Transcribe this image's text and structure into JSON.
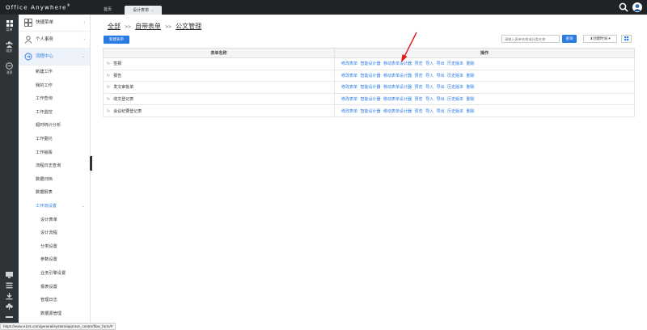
{
  "app": {
    "brand": "Office Anywhere",
    "brand_reg": "®",
    "tabs": [
      {
        "label": "首页"
      },
      {
        "label": "设计表单",
        "close": "×"
      }
    ]
  },
  "rail": {
    "items": [
      {
        "label": "菜单",
        "icon": "grid-icon"
      },
      {
        "label": "组织",
        "icon": "org-icon"
      },
      {
        "label": "消息",
        "icon": "message-icon"
      }
    ]
  },
  "sidebar": {
    "groups": [
      {
        "label": "快捷菜单",
        "icon": "shortcut-icon",
        "chevron": "›"
      },
      {
        "label": "个人事务",
        "icon": "person-icon",
        "chevron": "›"
      },
      {
        "label": "流程中心",
        "icon": "flow-icon",
        "chevron": "⌄"
      }
    ],
    "items": [
      "新建工作",
      "我的工作",
      "工作查询",
      "工作监控",
      "超时统计分析",
      "工作委托",
      "工作销毁",
      "流程日志查询",
      "数据归档",
      "数据报表"
    ],
    "sub_group": {
      "label": "工作流设置",
      "chevron": "⌄"
    },
    "sub_items": [
      "设计表单",
      "设计流程",
      "分类设置",
      "参数设置",
      "业务引擎设置",
      "报表设置",
      "管理日志",
      "数据源管理"
    ]
  },
  "main": {
    "breadcrumb": {
      "root": "全部",
      "sep": ">>",
      "level1": "自带表单",
      "level2": "公文管理"
    },
    "new_button": "新建表单",
    "search_placeholder": "请输入表单名称或分类名称",
    "search_button": "查询",
    "sort_button": "⬇创建时间 ▾",
    "table": {
      "headers": [
        "表单名称",
        "操作"
      ],
      "rows": [
        {
          "name": "签报"
        },
        {
          "name": "报告"
        },
        {
          "name": "发文审批单"
        },
        {
          "name": "收文登记表"
        },
        {
          "name": "会议纪要登记表"
        }
      ],
      "actions": [
        "修改表单",
        "智能设计器",
        "移动表单设计器",
        "预览",
        "导入",
        "导出",
        "历史版本",
        "删除"
      ]
    }
  },
  "statusbar": {
    "url": "https://www.e1ns.com/general/system/approve_center/flow_form/#"
  },
  "colors": {
    "accent": "#2a7be4",
    "topbar": "#1f2327",
    "rail": "#2e3338",
    "arrow": "#e21b1b"
  }
}
